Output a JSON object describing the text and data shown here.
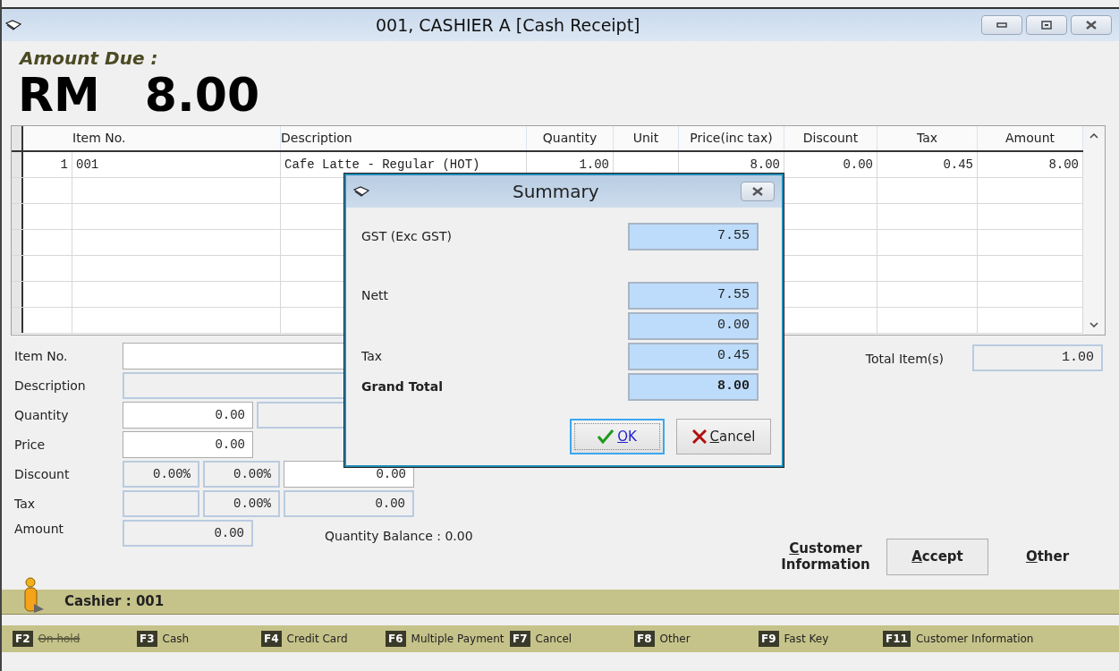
{
  "window": {
    "title": "001, CASHIER A [Cash Receipt]"
  },
  "amount_due": {
    "label": "Amount Due :",
    "currency": "RM",
    "value": "8.00"
  },
  "grid": {
    "columns": [
      "Item No.",
      "Description",
      "Quantity",
      "Unit",
      "Price(inc tax)",
      "Discount",
      "Tax",
      "Amount"
    ],
    "rows": [
      {
        "number": "1",
        "cells": [
          "001",
          "Cafe Latte - Regular (HOT)",
          "1.00",
          "",
          "8.00",
          "0.00",
          "0.45",
          "8.00"
        ]
      }
    ]
  },
  "form": [
    {
      "label": "Item No.",
      "fields": [
        {
          "kind": "editable"
        }
      ]
    },
    {
      "label": "Description",
      "fields": [
        {
          "kind": "readonly"
        }
      ]
    },
    {
      "label": "Quantity",
      "fields": [
        {
          "kind": "editable",
          "value": "0.00"
        },
        {
          "kind": "readonly"
        }
      ]
    },
    {
      "label": "Price",
      "fields": [
        {
          "kind": "editable",
          "value": "0.00"
        }
      ]
    },
    {
      "label": "Discount",
      "fields": [
        {
          "kind": "readonly",
          "value": "0.00%"
        },
        {
          "kind": "readonly",
          "value": "0.00%"
        },
        {
          "kind": "editable",
          "value": "0.00"
        }
      ]
    },
    {
      "label": "Tax",
      "fields": [
        {
          "kind": "readonly"
        },
        {
          "kind": "readonly",
          "value": "0.00%"
        },
        {
          "kind": "readonly",
          "value": "0.00"
        }
      ]
    },
    {
      "label": "Amount",
      "fields": [
        {
          "kind": "readonly",
          "value": "0.00"
        }
      ],
      "note": "Quantity Balance : 0.00"
    }
  ],
  "total_items": {
    "label": "Total Item(s)",
    "value": "1.00"
  },
  "actions": [
    {
      "label": "Customer Information",
      "kind": "link"
    },
    {
      "label": "Accept",
      "kind": "button"
    },
    {
      "label": "Other",
      "kind": "link"
    }
  ],
  "cashier_bar": {
    "label": "Cashier : 001"
  },
  "fkeys": [
    {
      "key": "F2",
      "label": "On hold",
      "disabled": true
    },
    {
      "key": "F3",
      "label": "Cash",
      "disabled": false
    },
    {
      "key": "F4",
      "label": "Credit Card",
      "disabled": false
    },
    {
      "key": "F6",
      "label": "Multiple Payment",
      "disabled": false
    },
    {
      "key": "F7",
      "label": "Cancel",
      "disabled": false
    },
    {
      "key": "F8",
      "label": "Other",
      "disabled": false
    },
    {
      "key": "F9",
      "label": "Fast Key",
      "disabled": false
    },
    {
      "key": "F11",
      "label": "Customer Information",
      "disabled": false
    }
  ],
  "dialog": {
    "title": "Summary",
    "groups": [
      [
        {
          "label": "GST (Exc GST)",
          "value": "7.55",
          "bold": false
        }
      ],
      [
        {
          "label": "Nett",
          "value": "7.55",
          "bold": false
        },
        {
          "value": "0.00",
          "bold": false
        },
        {
          "label": "Tax",
          "value": "0.45",
          "bold": false
        },
        {
          "label": "Grand Total",
          "value": "8.00",
          "bold": true
        }
      ]
    ],
    "buttons": [
      {
        "label": "OK",
        "kind": "ok",
        "focused": true
      },
      {
        "label": "Cancel",
        "kind": "cancel",
        "focused": false
      }
    ]
  }
}
